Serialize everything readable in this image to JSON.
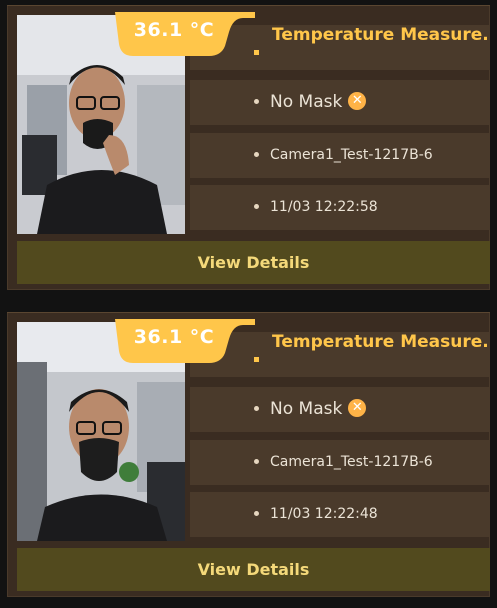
{
  "cards": [
    {
      "temperature": "36.1 °C",
      "title": "Temperature Measure...",
      "mask_status": "No Mask",
      "camera": "Camera1_Test-1217B-6",
      "timestamp": "11/03 12:22:58",
      "details_label": "View Details"
    },
    {
      "temperature": "36.1 °C",
      "title": "Temperature Measure...",
      "mask_status": "No Mask",
      "camera": "Camera1_Test-1217B-6",
      "timestamp": "11/03 12:22:48",
      "details_label": "View Details"
    }
  ],
  "icons": {
    "mask_alert": "x-circle-icon",
    "bullet": "bullet-dot-icon"
  },
  "colors": {
    "accent": "#ffc64a",
    "card_bg": "#3a2c21",
    "row_bg": "#4a3a2b",
    "details_bg": "#524a1e"
  }
}
